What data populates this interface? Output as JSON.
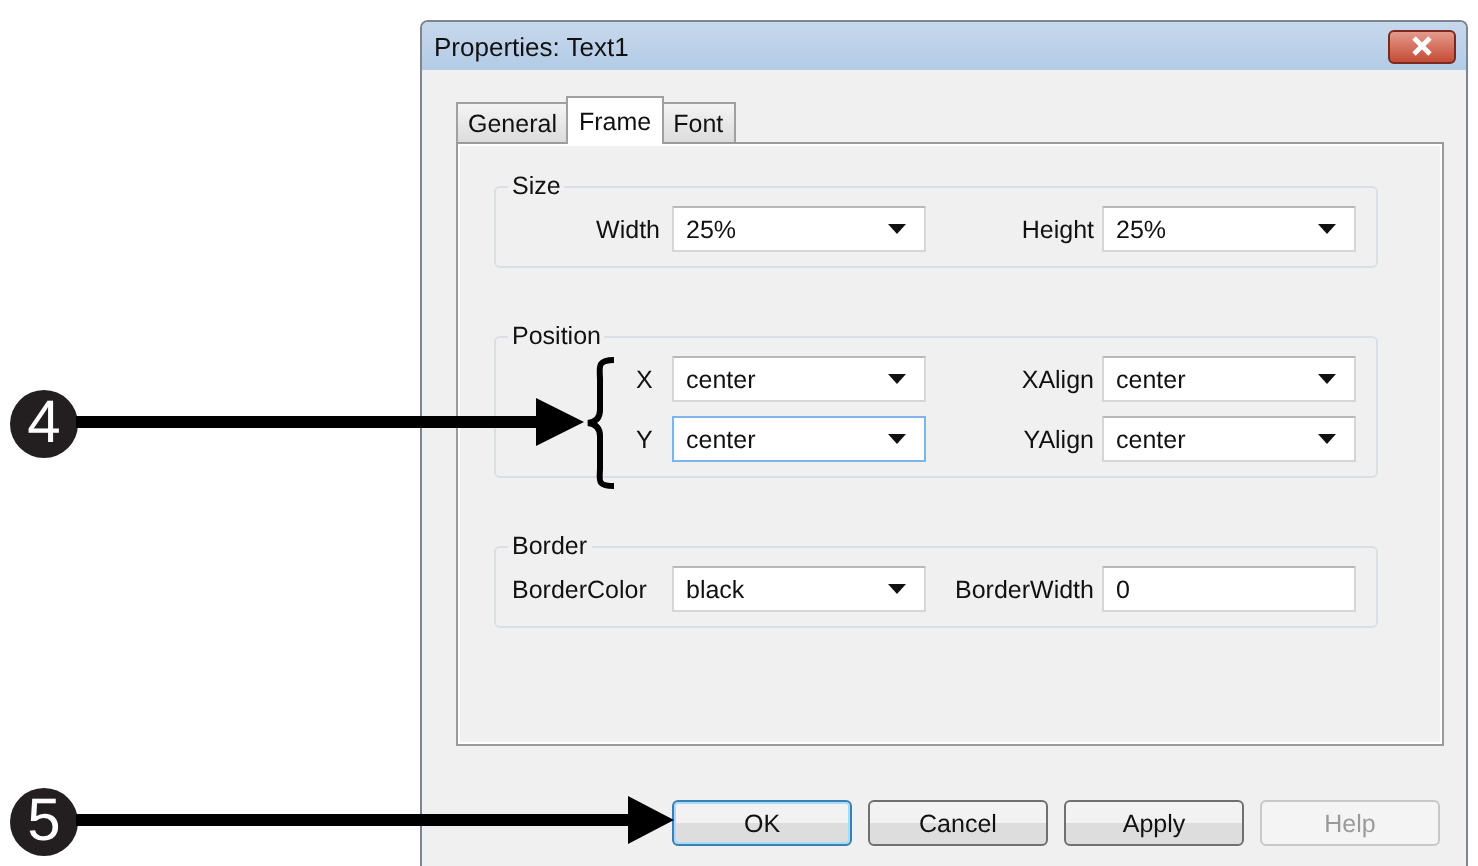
{
  "callouts": [
    {
      "number": "4"
    },
    {
      "number": "5"
    }
  ],
  "window": {
    "title": "Properties: Text1"
  },
  "tabs": [
    {
      "label": "General",
      "selected": false
    },
    {
      "label": "Frame",
      "selected": true
    },
    {
      "label": "Font",
      "selected": false
    }
  ],
  "groups": [
    {
      "title": "Size",
      "rows": [
        [
          {
            "label": "Width",
            "value": "25%",
            "kind": "dropdown",
            "focused": false
          },
          {
            "label": "Height",
            "value": "25%",
            "kind": "dropdown",
            "focused": false
          }
        ]
      ]
    },
    {
      "title": "Position",
      "rows": [
        [
          {
            "label": "X",
            "value": "center",
            "kind": "dropdown",
            "focused": false
          },
          {
            "label": "XAlign",
            "value": "center",
            "kind": "dropdown",
            "focused": false
          }
        ],
        [
          {
            "label": "Y",
            "value": "center",
            "kind": "dropdown",
            "focused": true
          },
          {
            "label": "YAlign",
            "value": "center",
            "kind": "dropdown",
            "focused": false
          }
        ]
      ]
    },
    {
      "title": "Border",
      "rows": [
        [
          {
            "label": "BorderColor",
            "value": "black",
            "kind": "dropdown",
            "focused": false
          },
          {
            "label": "BorderWidth",
            "value": "0",
            "kind": "text",
            "focused": false
          }
        ]
      ]
    }
  ],
  "buttons": [
    {
      "label": "OK",
      "default": true,
      "disabled": false
    },
    {
      "label": "Cancel",
      "default": false,
      "disabled": false
    },
    {
      "label": "Apply",
      "default": false,
      "disabled": false
    },
    {
      "label": "Help",
      "default": false,
      "disabled": true
    }
  ]
}
